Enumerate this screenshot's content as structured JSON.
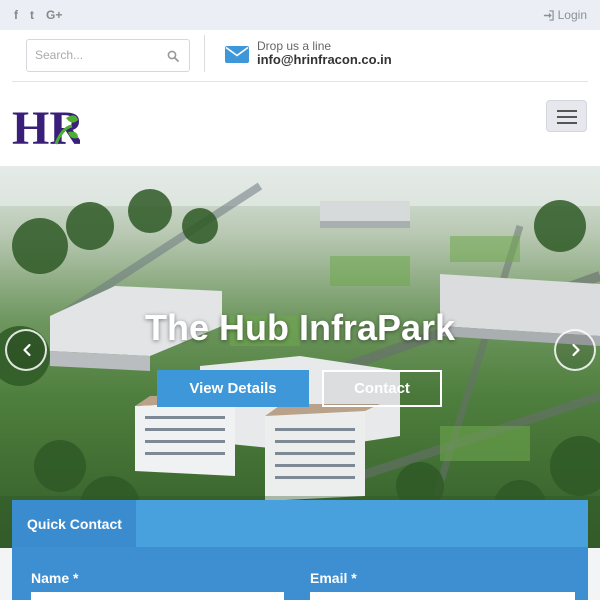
{
  "topbar": {
    "social": [
      {
        "icon": "facebook-icon",
        "glyph": "f"
      },
      {
        "icon": "twitter-icon",
        "glyph": "t"
      },
      {
        "icon": "google-plus-icon",
        "glyph": "G+"
      }
    ],
    "login_label": "Login"
  },
  "header": {
    "search_placeholder": "Search...",
    "drop_label": "Drop us a line",
    "email": "info@hrinfracon.co.in",
    "logo_text": "HR"
  },
  "hero": {
    "title": "The Hub InfraPark",
    "view_details_label": "View Details",
    "contact_label": "Contact"
  },
  "quick_contact": {
    "tab_label": "Quick Contact",
    "name_label": "Name *",
    "email_label": "Email *"
  },
  "colors": {
    "accent": "#3d97d8",
    "logo_purple": "#3a1f7a",
    "logo_green": "#4caf2f"
  }
}
